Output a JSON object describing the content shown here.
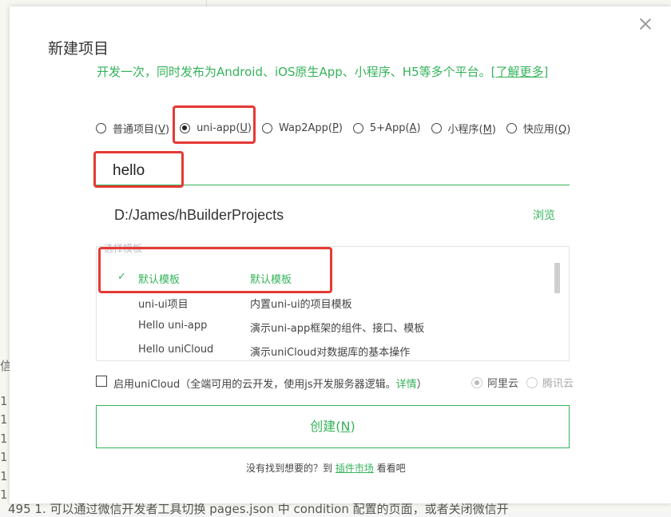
{
  "background": {
    "side_char": "信",
    "line_digits": [
      "1",
      "1",
      "1",
      "1",
      "1",
      "1"
    ],
    "bottom_text": "495 1. 可以通过微信开发者工具切换 pages.json 中 condition 配置的页面，或者关闭微信开"
  },
  "dialog": {
    "title": "新建项目",
    "subtitle": "开发一次，同时发布为Android、iOS原生App、小程序、H5等多个平台。",
    "learn_more": "[了解更多]",
    "project_types": [
      {
        "label": "普通项目(",
        "key": "V",
        "checked": false
      },
      {
        "label": "uni-app(",
        "key": "U",
        "checked": true
      },
      {
        "label": "Wap2App(",
        "key": "P",
        "checked": false
      },
      {
        "label": "5+App(",
        "key": "A",
        "checked": false
      },
      {
        "label": "小程序(",
        "key": "M",
        "checked": false
      },
      {
        "label": "快应用(",
        "key": "Q",
        "checked": false
      }
    ],
    "project_name": "hello",
    "project_path": "D:/James/hBuilderProjects",
    "browse_label": "浏览",
    "template_label": "选择模板",
    "templates": [
      {
        "check": "✓",
        "name": "默认模板",
        "desc": "默认模板",
        "selected": true
      },
      {
        "check": "",
        "name": "uni-ui项目",
        "desc": "内置uni-ui的项目模板",
        "selected": false
      },
      {
        "check": "",
        "name": "Hello uni-app",
        "desc": "演示uni-app框架的组件、接口、模板",
        "selected": false
      },
      {
        "check": "",
        "name": "Hello uniCloud",
        "desc": "演示uniCloud对数据库的基本操作",
        "selected": false
      }
    ],
    "unicloud": {
      "label": "启用uniCloud（全端可用的云开发，使用js开发服务器逻辑。",
      "link": "详情",
      "close": "）",
      "providers": [
        {
          "label": "阿里云",
          "checked": true
        },
        {
          "label": "腾讯云",
          "checked": false
        }
      ]
    },
    "create_button": {
      "label": "创建(",
      "key": "N",
      "close": ")"
    },
    "footer": {
      "prefix": "没有找到想要的？到 ",
      "link": "插件市场",
      "suffix": " 看看吧"
    }
  },
  "colors": {
    "accent": "#35b35b",
    "highlight": "#e53935"
  }
}
